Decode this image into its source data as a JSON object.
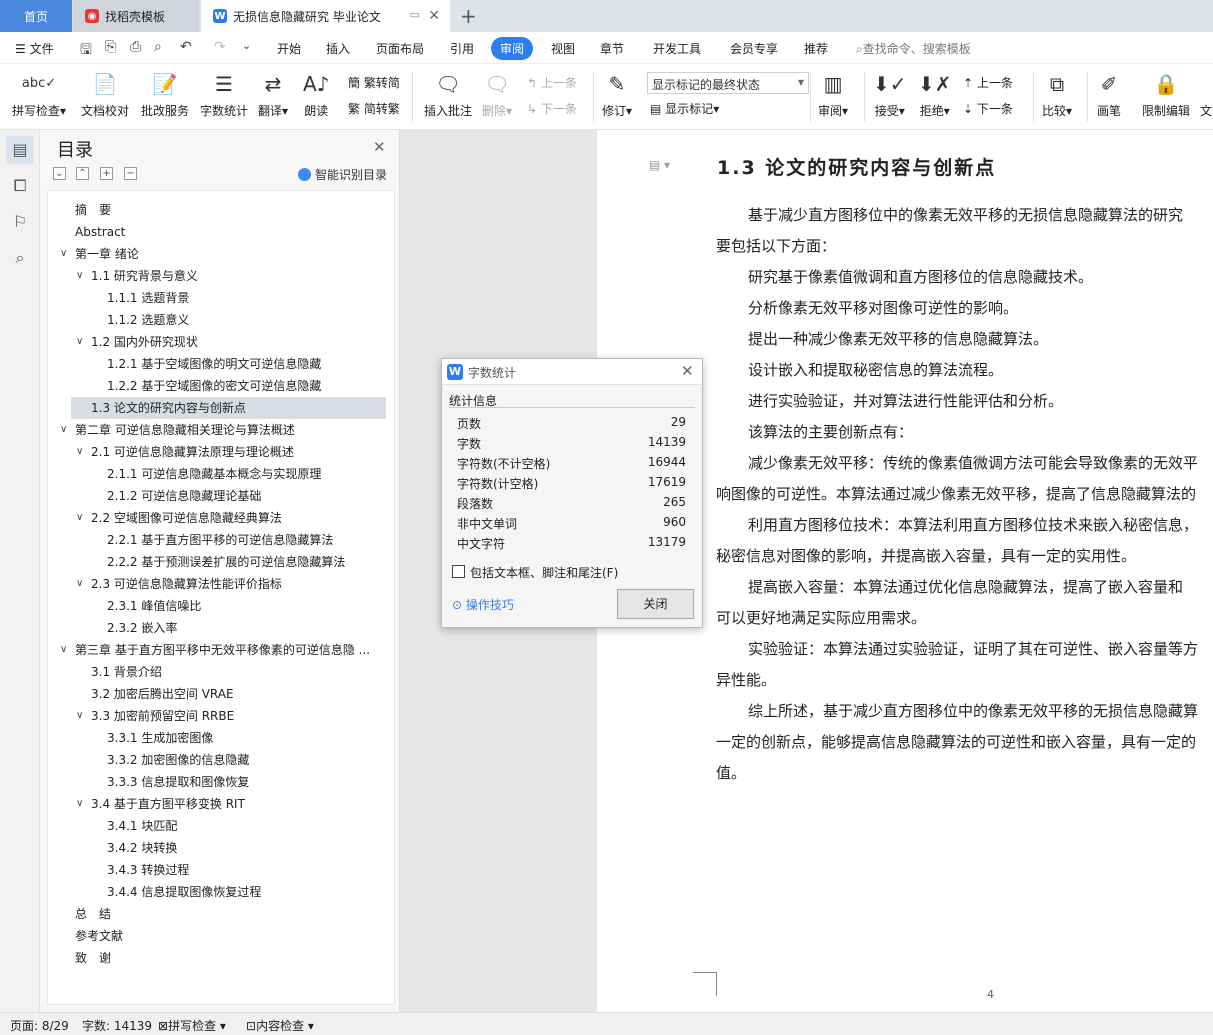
{
  "tabs": {
    "home": "首页",
    "templates": "找稻壳模板",
    "document": "无损信息隐藏研究 毕业论文"
  },
  "menu": {
    "file": "文件",
    "items": [
      "开始",
      "插入",
      "页面布局",
      "引用",
      "审阅",
      "视图",
      "章节",
      "开发工具",
      "会员专享",
      "推荐"
    ],
    "active": "审阅",
    "search_placeholder": "查找命令、搜索模板"
  },
  "ribbon": {
    "spell_check": "拼写检查",
    "doc_proof": "文档校对",
    "revision_service": "批改服务",
    "word_count": "字数统计",
    "translate": "翻译",
    "read_aloud": "朗读",
    "trad_to_simp": "繁转简",
    "simp_to_trad": "简转繁",
    "insert_comment": "插入批注",
    "delete": "删除",
    "prev_comment": "上一条",
    "next_comment": "下一条",
    "track_changes": "修订",
    "markup_state": "显示标记的最终状态",
    "show_markup": "显示标记",
    "review": "审阅",
    "accept": "接受",
    "reject": "拒绝",
    "prev_change": "上一条",
    "next_change": "下一条",
    "compare": "比较",
    "pen": "画笔",
    "restrict_edit": "限制编辑",
    "more": "文"
  },
  "toc": {
    "title": "目录",
    "smart_label": "智能识别目录",
    "items": [
      {
        "text": "摘　要",
        "level": 0,
        "arrow": false
      },
      {
        "text": "Abstract",
        "level": 0,
        "arrow": false
      },
      {
        "text": "第一章  绪论",
        "level": 0,
        "arrow": true
      },
      {
        "text": "1.1  研究背景与意义",
        "level": 1,
        "arrow": true
      },
      {
        "text": "1.1.1 选题背景",
        "level": 2,
        "arrow": false
      },
      {
        "text": "1.1.2 选题意义",
        "level": 2,
        "arrow": false
      },
      {
        "text": "1.2  国内外研究现状",
        "level": 1,
        "arrow": true
      },
      {
        "text": "1.2.1  基于空域图像的明文可逆信息隐藏",
        "level": 2,
        "arrow": false
      },
      {
        "text": "1.2.2  基于空域图像的密文可逆信息隐藏",
        "level": 2,
        "arrow": false
      },
      {
        "text": "1.3  论文的研究内容与创新点",
        "level": 1,
        "arrow": false,
        "selected": true
      },
      {
        "text": "第二章  可逆信息隐藏相关理论与算法概述",
        "level": 0,
        "arrow": true
      },
      {
        "text": "2.1  可逆信息隐藏算法原理与理论概述",
        "level": 1,
        "arrow": true
      },
      {
        "text": "2.1.1  可逆信息隐藏基本概念与实现原理",
        "level": 2,
        "arrow": false
      },
      {
        "text": "2.1.2  可逆信息隐藏理论基础",
        "level": 2,
        "arrow": false
      },
      {
        "text": "2.2  空域图像可逆信息隐藏经典算法",
        "level": 1,
        "arrow": true
      },
      {
        "text": "2.2.1  基于直方图平移的可逆信息隐藏算法",
        "level": 2,
        "arrow": false
      },
      {
        "text": "2.2.2  基于预测误差扩展的可逆信息隐藏算法",
        "level": 2,
        "arrow": false
      },
      {
        "text": "2.3  可逆信息隐藏算法性能评价指标",
        "level": 1,
        "arrow": true
      },
      {
        "text": "2.3.1  峰值信噪比",
        "level": 2,
        "arrow": false
      },
      {
        "text": "2.3.2  嵌入率",
        "level": 2,
        "arrow": false
      },
      {
        "text": "第三章  基于直方图平移中无效平移像素的可逆信息隐 ...",
        "level": 0,
        "arrow": true
      },
      {
        "text": "3.1 背景介绍",
        "level": 1,
        "arrow": false
      },
      {
        "text": "3.2 加密后腾出空间 VRAE",
        "level": 1,
        "arrow": false
      },
      {
        "text": "3.3 加密前预留空间 RRBE",
        "level": 1,
        "arrow": true
      },
      {
        "text": "3.3.1 生成加密图像",
        "level": 2,
        "arrow": false
      },
      {
        "text": "3.3.2 加密图像的信息隐藏",
        "level": 2,
        "arrow": false
      },
      {
        "text": "3.3.3 信息提取和图像恢复",
        "level": 2,
        "arrow": false
      },
      {
        "text": "3.4 基于直方图平移变换 RIT",
        "level": 1,
        "arrow": true
      },
      {
        "text": "3.4.1 块匹配",
        "level": 2,
        "arrow": false
      },
      {
        "text": "3.4.2 块转换",
        "level": 2,
        "arrow": false
      },
      {
        "text": "3.4.3 转换过程",
        "level": 2,
        "arrow": false
      },
      {
        "text": "3.4.4 信息提取图像恢复过程",
        "level": 2,
        "arrow": false
      },
      {
        "text": "总　结",
        "level": 0,
        "arrow": false
      },
      {
        "text": "参考文献",
        "level": 0,
        "arrow": false
      },
      {
        "text": "致　谢",
        "level": 0,
        "arrow": false
      }
    ]
  },
  "document": {
    "heading": "1.3  论文的研究内容与创新点",
    "paragraphs": [
      {
        "text": "基于减少直方图移位中的像素无效平移的无损信息隐藏算法的研究",
        "indent": true
      },
      {
        "text": "要包括以下方面：",
        "indent": false
      },
      {
        "text": "研究基于像素值微调和直方图移位的信息隐藏技术。",
        "indent": true
      },
      {
        "text": "分析像素无效平移对图像可逆性的影响。",
        "indent": true
      },
      {
        "text": "提出一种减少像素无效平移的信息隐藏算法。",
        "indent": true
      },
      {
        "text": "设计嵌入和提取秘密信息的算法流程。",
        "indent": true
      },
      {
        "text": "进行实验验证，并对算法进行性能评估和分析。",
        "indent": true
      },
      {
        "text": "该算法的主要创新点有：",
        "indent": true
      },
      {
        "text": "减少像素无效平移：传统的像素值微调方法可能会导致像素的无效平",
        "indent": true
      },
      {
        "text": "响图像的可逆性。本算法通过减少像素无效平移，提高了信息隐藏算法的",
        "indent": false
      },
      {
        "text": "利用直方图移位技术：本算法利用直方图移位技术来嵌入秘密信息，",
        "indent": true
      },
      {
        "text": "秘密信息对图像的影响，并提高嵌入容量，具有一定的实用性。",
        "indent": false
      },
      {
        "text": "提高嵌入容量：本算法通过优化信息隐藏算法，提高了嵌入容量和",
        "indent": true
      },
      {
        "text": "可以更好地满足实际应用需求。",
        "indent": false
      },
      {
        "text": "实验验证：本算法通过实验验证，证明了其在可逆性、嵌入容量等方",
        "indent": true
      },
      {
        "text": "异性能。",
        "indent": false
      },
      {
        "text": "综上所述，基于减少直方图移位中的像素无效平移的无损信息隐藏算",
        "indent": true
      },
      {
        "text": "一定的创新点，能够提高信息隐藏算法的可逆性和嵌入容量，具有一定的",
        "indent": false
      },
      {
        "text": "值。",
        "indent": false
      }
    ],
    "page_number": "4"
  },
  "dialog": {
    "title": "字数统计",
    "section": "统计信息",
    "stats": [
      {
        "label": "页数",
        "value": "29"
      },
      {
        "label": "字数",
        "value": "14139"
      },
      {
        "label": "字符数(不计空格)",
        "value": "16944"
      },
      {
        "label": "字符数(计空格)",
        "value": "17619"
      },
      {
        "label": "段落数",
        "value": "265"
      },
      {
        "label": "非中文单词",
        "value": "960"
      },
      {
        "label": "中文字符",
        "value": "13179"
      }
    ],
    "checkbox_label": "包括文本框、脚注和尾注(F)",
    "checkbox_checked": false,
    "tip_link": "操作技巧",
    "close_button": "关闭"
  },
  "status": {
    "page": "页面: 8/29",
    "word_count": "字数: 14139",
    "spell_check": "拼写检查",
    "content_check": "内容检查"
  }
}
